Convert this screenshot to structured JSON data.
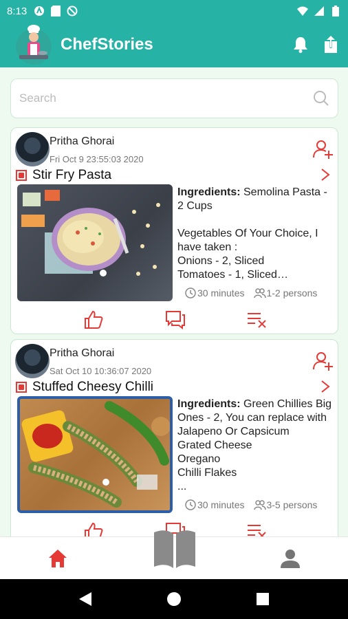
{
  "status": {
    "time": "8:13"
  },
  "app": {
    "title": "ChefStories"
  },
  "search": {
    "placeholder": "Search",
    "value": ""
  },
  "posts": [
    {
      "author": "Pritha Ghorai",
      "datetime": "Fri Oct  9 23:55:03 2020",
      "title": "Stir Fry Pasta",
      "ingredients_label": "Ingredients:",
      "ingredients_text": " Semolina Pasta - 2 Cups\n\nVegetables Of Your Choice, I have taken :\nOnions - 2, Sliced\nTomatoes - 1, Sliced…",
      "time": "30 minutes",
      "serves": "1-2 persons"
    },
    {
      "author": "Pritha Ghorai",
      "datetime": "Sat Oct 10 10:36:07 2020",
      "title": "Stuffed Cheesy Chilli",
      "ingredients_label": "Ingredients:",
      "ingredients_text": " Green Chillies Big Ones - 2, You can replace with Jalapeno Or Capsicum\nGrated Cheese\nOregano\nChilli Flakes\n...",
      "time": "30 minutes",
      "serves": "3-5 persons"
    }
  ],
  "colors": {
    "primary": "#26b3a6",
    "accent": "#e53935",
    "background": "#eefaf0"
  }
}
